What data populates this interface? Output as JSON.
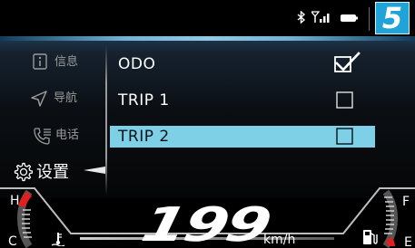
{
  "status_bar": {
    "icons": [
      "bluetooth-icon",
      "signal-icon",
      "battery-icon"
    ],
    "gear": "5",
    "gear_color": "#1fa3d9"
  },
  "sidebar": {
    "items": [
      {
        "label": "信息",
        "icon": "info-icon"
      },
      {
        "label": "导航",
        "icon": "navigation-icon"
      },
      {
        "label": "电话",
        "icon": "phone-icon"
      },
      {
        "label": "设置",
        "icon": "settings-gear-icon",
        "active": true
      }
    ]
  },
  "options": [
    {
      "label": "ODO",
      "checked": true
    },
    {
      "label": "TRIP 1",
      "checked": false
    },
    {
      "label": "TRIP 2",
      "checked": false,
      "selected": true
    }
  ],
  "highlight_color": "#7dd0e6",
  "instrument": {
    "speed": "199",
    "speed_unit": "km/h",
    "temp_hot": "H",
    "temp_cold": "C",
    "fuel_full": "F",
    "fuel_empty": "E",
    "icons": [
      "coolant-temp-icon",
      "fuel-pump-icon"
    ],
    "warning_color": "#e02020"
  }
}
